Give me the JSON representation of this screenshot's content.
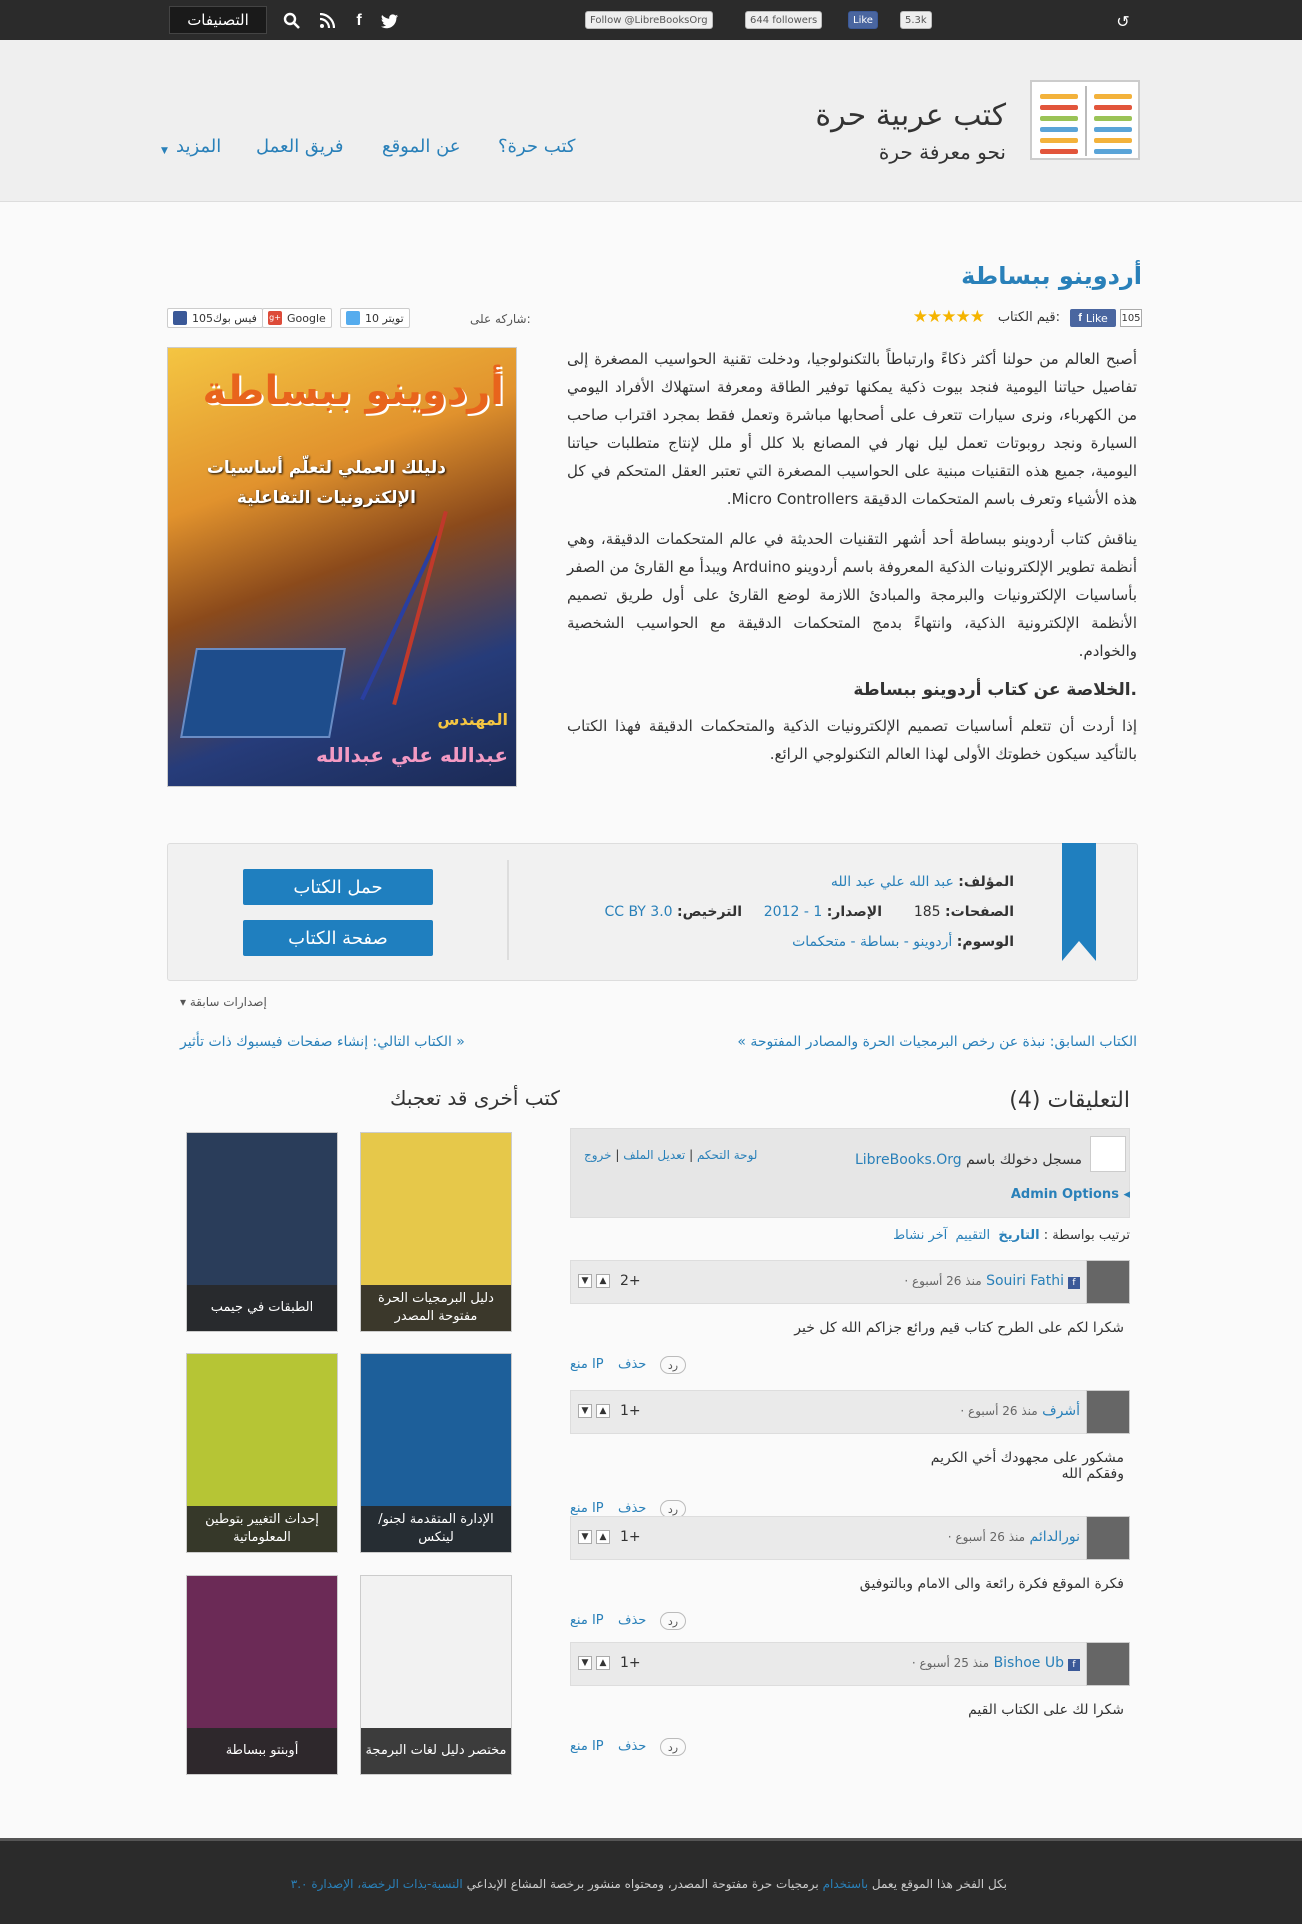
{
  "topbar": {
    "categories_label": "التصنيفات",
    "follow_label": "Follow @LibreBooksOrg",
    "followers": "644 followers",
    "like_label": "Like",
    "like_count": "5.3k",
    "icons": [
      "search-icon",
      "rss-icon",
      "facebook-icon",
      "twitter-icon",
      "refresh-icon"
    ]
  },
  "header": {
    "site_title": "كتب عربية حرة",
    "site_subtitle": "نحو معرفة حرة",
    "nav": [
      "كتب حرة؟",
      "عن الموقع",
      "فريق العمل",
      "المزيد"
    ]
  },
  "book": {
    "title": "أردوينو ببساطة",
    "rate_label": "قيم الكتاب:",
    "fb_like": "Like",
    "fb_count": "105",
    "share_label": "شاركه على:",
    "share": {
      "twitter": "تويتر 10",
      "google": "Google",
      "facebook": "فيس بوك105"
    },
    "cover": {
      "title": "أردوينو ببساطة",
      "subtitle1": "دليلك العملي لتعلّم أساسيات",
      "subtitle2": "الإلكترونيات التفاعلية",
      "author_prefix": "المهندس",
      "author": "عبدالله علي عبدالله"
    },
    "desc_p1": "أصبح العالم من حولنا أكثر ذكاءً وارتباطاً بالتكنولوجيا، ودخلت تقنية الحواسيب المصغرة إلى تفاصيل حياتنا اليومية فنجد بيوت ذكية يمكنها توفير الطاقة ومعرفة استهلاك الأفراد اليومي من الكهرباء، ونرى سيارات تتعرف على أصحابها مباشرة وتعمل فقط بمجرد اقتراب صاحب السيارة ونجد روبوتات تعمل ليل نهار في المصانع بلا كلل أو ملل لإنتاج متطلبات حياتنا اليومية، جميع هذه التقنيات مبنية على الحواسيب المصغرة التي تعتبر العقل المتحكم في كل هذه الأشياء وتعرف باسم المتحكمات الدقيقة Micro Controllers.",
    "desc_p2": "يناقش كتاب أردوينو ببساطة أحد أشهر التقنيات الحديثة في عالم المتحكمات الدقيقة، وهي أنظمة تطوير الإلكترونيات الذكية المعروفة باسم أردوينو Arduino ويبدأ مع القارئ من الصفر بأساسيات الإلكترونيات والبرمجة والمبادئ اللازمة لوضع القارئ على أول طريق تصميم الأنظمة الإلكترونية الذكية، وانتهاءً بدمج المتحكمات الدقيقة مع الحواسيب الشخصية والخوادم.",
    "summary_heading": "الخلاصة عن كتاب أردوينو ببساطة.",
    "summary_text": "إذا أردت أن تتعلم أساسيات تصميم الإلكترونيات الذكية والمتحكمات الدقيقة فهذا الكتاب بالتأكيد سيكون خطوتك الأولى لهذا العالم التكنولوجي الرائع.",
    "rating": "5"
  },
  "info": {
    "author_label": "المؤلف:",
    "author": "عبد الله علي عبد الله",
    "pages_label": "الصفحات:",
    "pages": "185",
    "edition_label": "الإصدار:",
    "edition": "1 - 2012",
    "license_label": "الترخيص:",
    "license": "CC BY 3.0",
    "tags_label": "الوسوم:",
    "tags": "أردوينو - بساطة - متحكمات",
    "download_label": "حمل الكتاب",
    "bookpage_label": "صفحة الكتاب",
    "previous_editions": "إصدارات سابقة"
  },
  "nav_links": {
    "prev": "« الكتاب السابق: نبذة عن رخص البرمجيات الحرة والمصادر المفتوحة",
    "next": "الكتاب التالي: إنشاء صفحات فيسبوك ذات تأثير »"
  },
  "related": {
    "heading": "كتب أخرى قد تعجبك",
    "books": [
      {
        "caption": "دليل البرمجيات الحرة مفتوحة المصدر",
        "color": "#e6c84a"
      },
      {
        "caption": "الطبقات في جيمب",
        "color": "#2a3d5a"
      },
      {
        "caption": "الإدارة المتقدمة لجنو/لينكس",
        "color": "#1d5f9a"
      },
      {
        "caption": "إحداث التغيير بتوطين المعلوماتية",
        "color": "#b6c535"
      },
      {
        "caption": "مختصر دليل لغات البرمجة",
        "color": "#f2f2f2"
      },
      {
        "caption": "أوبنتو ببساطة",
        "color": "#6b2a56"
      }
    ]
  },
  "comments": {
    "heading": "التعليقات (4)",
    "logged_in": "مسجل دخولك باسم",
    "username": "LibreBooks.Org",
    "dashboard": "لوحة التحكم",
    "edit_profile": "تعديل الملف",
    "logout": "خروج",
    "admin_options": "Admin Options",
    "sort_label": "ترتيب بواسطة :",
    "sort": [
      "التاريخ",
      "التقييم",
      "آخر نشاط"
    ],
    "reply": "رد",
    "delete": "حذف",
    "ban": "منع IP",
    "items": [
      {
        "name": "Souiri Fathi",
        "time": "منذ 26 أسبوع ·",
        "text": "شكرا لكم على الطرح كتاب قيم ورائع جزاكم الله كل خير",
        "score": "2+",
        "fb": true
      },
      {
        "name": "أشرف",
        "time": "منذ 26 أسبوع ·",
        "text": "مشكور على مجهودك أخي الكريم",
        "text2": "وفقكم الله",
        "score": "1+",
        "fb": false
      },
      {
        "name": "نورالدائم",
        "time": "منذ 26 أسبوع ·",
        "text": "فكرة الموقع فكرة رائعة والى الامام وبالتوفيق",
        "score": "1+",
        "fb": false
      },
      {
        "name": "Bishoe Ub",
        "time": "منذ 25 أسبوع ·",
        "text": "شكرا لك على الكتاب القيم",
        "score": "1+",
        "fb": true
      }
    ]
  },
  "footer": {
    "text_prefix": "بكل الفخر هذا الموقع يعمل",
    "link1": "باستخدام",
    "text_mid": "برمجيات حرة مفتوحة المصدر، ومحتواه منشور برخصة المشاع الإبداعي",
    "link2": "النسبة-بذات الرخصة، الإصدارة ٣.٠"
  },
  "colors": {
    "accent": "#2980b9",
    "ribbon": "#1f7fbf",
    "dark": "#2b2b2b"
  }
}
